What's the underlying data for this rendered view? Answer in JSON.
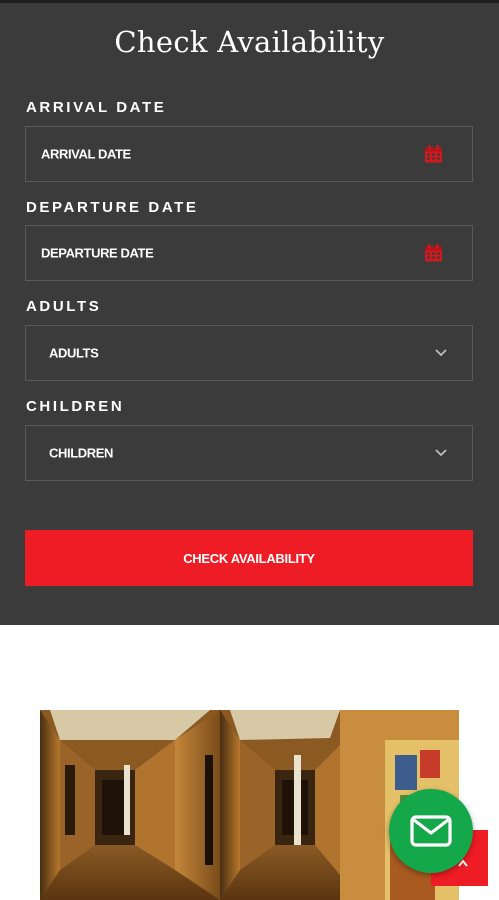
{
  "form": {
    "title": "Check Availability",
    "arrival": {
      "label": "ARRIVAL DATE",
      "placeholder": "ARRIVAL DATE",
      "icon": "calendar-icon"
    },
    "departure": {
      "label": "DEPARTURE DATE",
      "placeholder": "DEPARTURE DATE",
      "icon": "calendar-icon"
    },
    "adults": {
      "label": "ADULTS",
      "selected": "ADULTS",
      "icon": "chevron-down-icon"
    },
    "children": {
      "label": "CHILDREN",
      "selected": "CHILDREN",
      "icon": "chevron-down-icon"
    },
    "submit_label": "CHECK AVAILABILITY"
  },
  "colors": {
    "panel_bg": "#3b3b3b",
    "accent_red": "#ee1c24",
    "fab_green": "#15a84a"
  },
  "floating": {
    "mail_icon": "mail-icon",
    "scroll_top_icon": "chevron-up-icon"
  }
}
